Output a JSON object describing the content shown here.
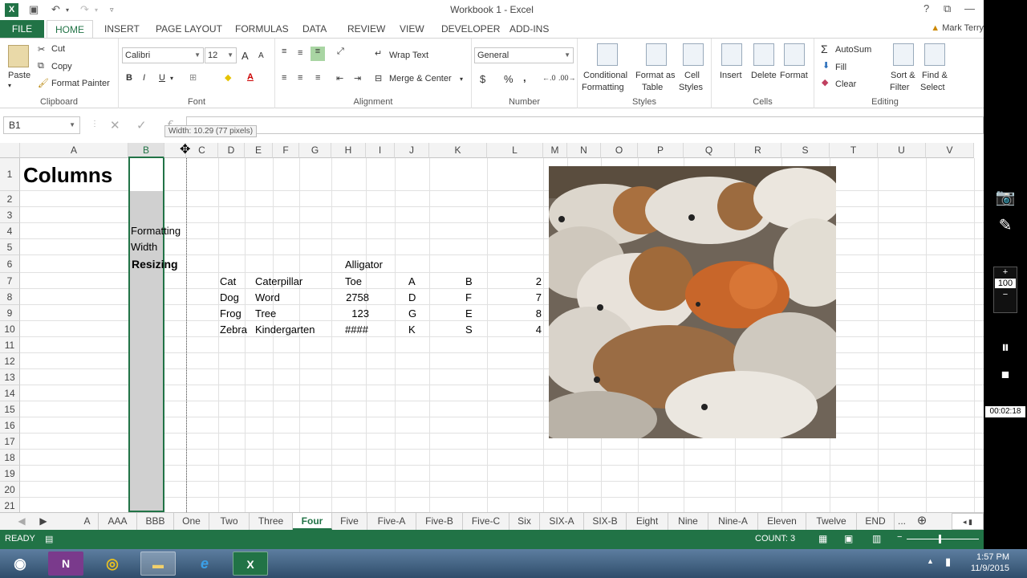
{
  "window": {
    "title": "Workbook 1 - Excel",
    "help": "?"
  },
  "ribbon_tabs": [
    "FILE",
    "HOME",
    "INSERT",
    "PAGE LAYOUT",
    "FORMULAS",
    "DATA",
    "REVIEW",
    "VIEW",
    "DEVELOPER",
    "ADD-INS"
  ],
  "user": "Mark Terry",
  "ribbon": {
    "clipboard": {
      "paste": "Paste",
      "cut": "Cut",
      "copy": "Copy",
      "format_painter": "Format Painter",
      "label": "Clipboard"
    },
    "font": {
      "name": "Calibri",
      "size": "12",
      "bold": "B",
      "italic": "I",
      "underline": "U",
      "grow": "A",
      "shrink": "A",
      "color_letter": "A",
      "label": "Font"
    },
    "alignment": {
      "wrap_text": "Wrap Text",
      "merge_center": "Merge & Center",
      "label": "Alignment"
    },
    "number": {
      "format": "General",
      "currency": "$",
      "percent": "%",
      "comma": ",",
      "label": "Number"
    },
    "styles": {
      "conditional": "Conditional",
      "conditional2": "Formatting",
      "format_table": "Format as",
      "format_table2": "Table",
      "cell_styles": "Cell",
      "cell_styles2": "Styles",
      "label": "Styles"
    },
    "cells": {
      "insert": "Insert",
      "delete": "Delete",
      "format": "Format",
      "label": "Cells"
    },
    "editing": {
      "autosum": "AutoSum",
      "fill": "Fill",
      "clear": "Clear",
      "sort": "Sort &",
      "sort2": "Filter",
      "find": "Find &",
      "find2": "Select",
      "label": "Editing"
    }
  },
  "formula_bar": {
    "name_box": "B1",
    "fx": "f",
    "tooltip": "Width: 10.29 (77 pixels)"
  },
  "columns": [
    "A",
    "B",
    "C",
    "D",
    "E",
    "F",
    "G",
    "H",
    "I",
    "J",
    "K",
    "L",
    "M",
    "N",
    "O",
    "P",
    "Q",
    "R",
    "S",
    "T",
    "U",
    "V"
  ],
  "rows": [
    "1",
    "2",
    "3",
    "4",
    "5",
    "6",
    "7",
    "8",
    "9",
    "10",
    "11",
    "12",
    "13",
    "14",
    "15",
    "16",
    "17",
    "18",
    "19",
    "20",
    "21"
  ],
  "cells": {
    "a1": "Columns",
    "b4": "Formatting",
    "b5": "Width",
    "b6": "Resizing",
    "h6": "Alligator",
    "table": [
      {
        "d": "Cat",
        "e": "Caterpillar",
        "h": "Toe",
        "j": "A",
        "k": "B",
        "l": "2"
      },
      {
        "d": "Dog",
        "e": "Word",
        "h": "2758",
        "j": "D",
        "k": "F",
        "l": "7"
      },
      {
        "d": "Frog",
        "e": "Tree",
        "h": "123",
        "j": "G",
        "k": "E",
        "l": "8"
      },
      {
        "d": "Zebra",
        "e": "Kindergarten",
        "h": "####",
        "j": "K",
        "k": "S",
        "l": "4"
      }
    ]
  },
  "sheet_tabs": [
    "A",
    "AAA",
    "BBB",
    "One",
    "Two",
    "Three",
    "Four",
    "Five",
    "Five-A",
    "Five-B",
    "Five-C",
    "Six",
    "SIX-A",
    "SIX-B",
    "Eight",
    "Nine",
    "Nine-A",
    "Eleven",
    "Twelve",
    "END"
  ],
  "sheet_more": "...",
  "active_sheet": "Four",
  "status": {
    "ready": "READY",
    "count": "COUNT: 3"
  },
  "recorder": {
    "zoom_plus": "+",
    "zoom_value": "100",
    "zoom_minus": "−",
    "timer": "00:02:18"
  },
  "taskbar": {
    "time": "1:57 PM",
    "date": "11/9/2015"
  },
  "colors": {
    "excel_green": "#217346",
    "selection_gray": "#d0d0d0"
  }
}
